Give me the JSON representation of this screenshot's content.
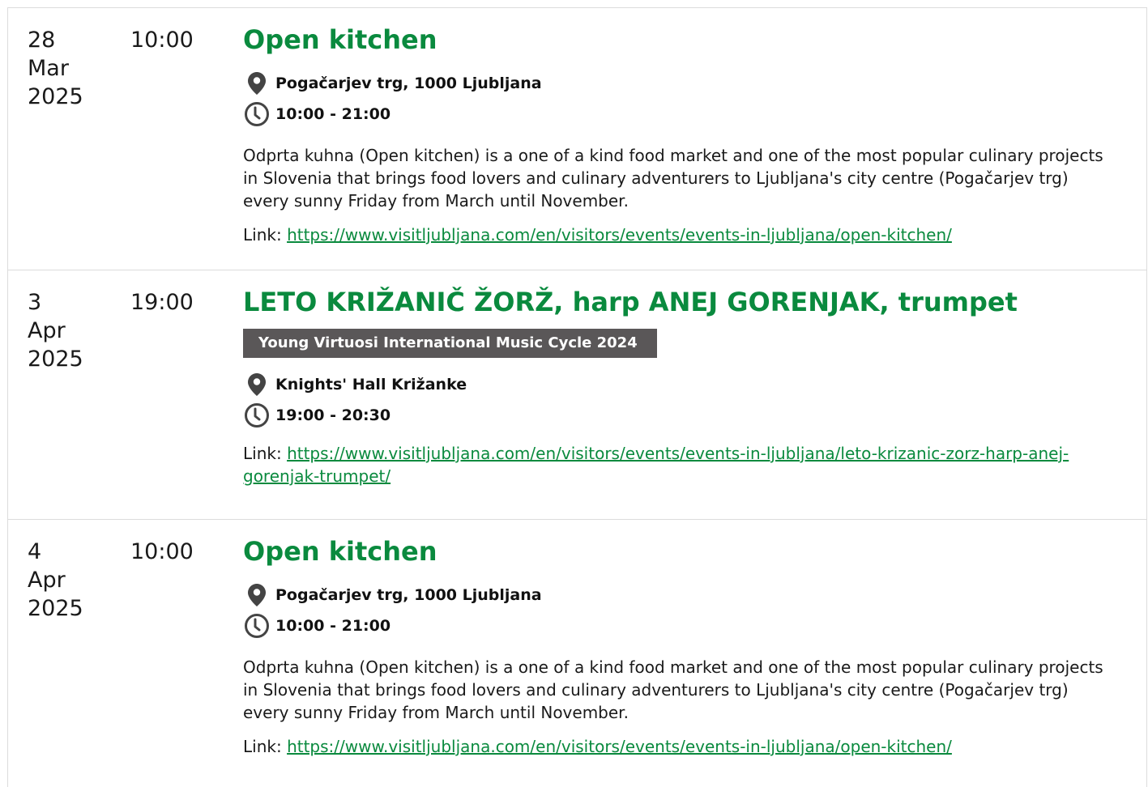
{
  "events": [
    {
      "date_day": "28",
      "date_month": "Mar",
      "date_year": "2025",
      "time": "10:00",
      "title": "Open kitchen",
      "location": "Pogačarjev trg, 1000 Ljubljana",
      "hours": "10:00 - 21:00",
      "description": "Odprta kuhna (Open kitchen) is a one of a kind food market and one of the most popular culinary projects in Slovenia that brings food lovers and culinary adventurers to Ljubljana's city centre (Pogačarjev trg) every sunny Friday from March until November.",
      "link_label": "Link:",
      "link_url": "https://www.visitljubljana.com/en/visitors/events/events-in-ljubljana/open-kitchen/"
    },
    {
      "date_day": "3",
      "date_month": "Apr",
      "date_year": "2025",
      "time": "19:00",
      "title": "LETO KRIŽANIČ ŽORŽ, harp ANEJ GORENJAK, trumpet",
      "tag": "Young Virtuosi International Music Cycle 2024",
      "location": "Knights' Hall Križanke",
      "hours": "19:00 - 20:30",
      "link_label": "Link:",
      "link_url": "https://www.visitljubljana.com/en/visitors/events/events-in-ljubljana/leto-krizanic-zorz-harp-anej-gorenjak-trumpet/"
    },
    {
      "date_day": "4",
      "date_month": "Apr",
      "date_year": "2025",
      "time": "10:00",
      "title": "Open kitchen",
      "location": "Pogačarjev trg, 1000 Ljubljana",
      "hours": "10:00 - 21:00",
      "description": "Odprta kuhna (Open kitchen) is a one of a kind food market and one of the most popular culinary projects in Slovenia that brings food lovers and culinary adventurers to Ljubljana's city centre (Pogačarjev trg) every sunny Friday from March until November.",
      "link_label": "Link:",
      "link_url": "https://www.visitljubljana.com/en/visitors/events/events-in-ljubljana/open-kitchen/"
    }
  ],
  "colors": {
    "accent": "#0a8a3e",
    "tag_bg": "#5a5758",
    "icon": "#444444"
  },
  "icons": {
    "location": "map-pin-icon",
    "time": "clock-icon"
  }
}
